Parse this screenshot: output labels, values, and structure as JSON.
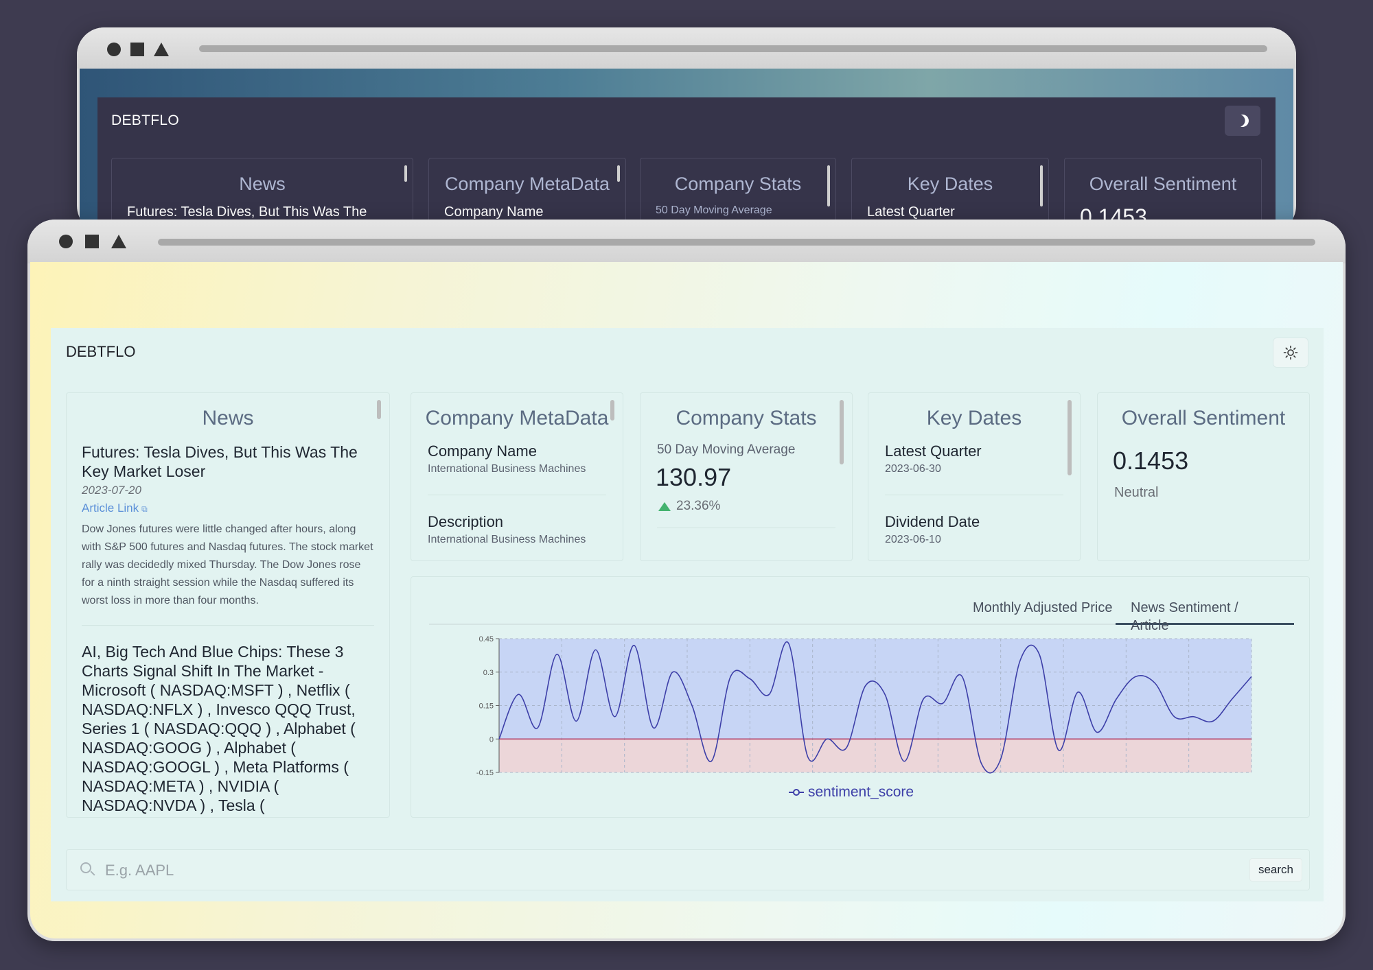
{
  "back_window": {
    "brand": "DEBTFLO",
    "theme_toggle_icon": "moon-icon",
    "cards": [
      {
        "title": "News",
        "peek": "Futures: Tesla Dives, But This Was The"
      },
      {
        "title": "Company MetaData",
        "peek": "Company Name"
      },
      {
        "title": "Company Stats",
        "peek": "50 Day Moving Average"
      },
      {
        "title": "Key Dates",
        "peek": "Latest Quarter"
      },
      {
        "title": "Overall Sentiment",
        "peek": "0.1453"
      }
    ]
  },
  "app": {
    "brand": "DEBTFLO",
    "theme_toggle_icon": "sun-icon"
  },
  "news": {
    "title": "News",
    "items": [
      {
        "title": "Futures: Tesla Dives, But This Was The Key Market Loser",
        "date": "2023-07-20",
        "link_text": "Article Link",
        "description": "Dow Jones futures were little changed after hours, along with S&P 500 futures and Nasdaq futures. The stock market rally was decidedly mixed Thursday. The Dow Jones rose for a ninth straight session while the Nasdaq suffered its worst loss in more than four months."
      },
      {
        "title": "AI, Big Tech And Blue Chips: These 3 Charts Signal Shift In The Market - Microsoft ( NASDAQ:MSFT ) , Netflix ( NASDAQ:NFLX ) , Invesco QQQ Trust, Series 1 ( NASDAQ:QQQ ) , Alphabet ( NASDAQ:GOOG ) , Alphabet ( NASDAQ:GOOGL ) , Meta Platforms ( NASDAQ:META ) , NVIDIA ( NASDAQ:NVDA ) , Tesla ( NASDAQ:TSLA )"
      }
    ]
  },
  "metadata": {
    "title": "Company MetaData",
    "fields": [
      {
        "label": "Company Name",
        "value": "International Business Machines"
      },
      {
        "label": "Description",
        "value": "International Business Machines"
      }
    ]
  },
  "stats": {
    "title": "Company Stats",
    "label": "50 Day Moving Average",
    "value": "130.97",
    "change": "23.36%",
    "change_color": "#43b36f"
  },
  "key_dates": {
    "title": "Key Dates",
    "fields": [
      {
        "label": "Latest Quarter",
        "value": "2023-06-30"
      },
      {
        "label": "Dividend Date",
        "value": "2023-06-10"
      }
    ]
  },
  "sentiment": {
    "title": "Overall Sentiment",
    "value": "0.1453",
    "label": "Neutral"
  },
  "chart_tabs": {
    "tab1": "Monthly Adjusted Price",
    "tab2": "News Sentiment / Article",
    "active": "tab2"
  },
  "chart_data": {
    "type": "line",
    "series": [
      {
        "name": "sentiment_score",
        "color": "#3d3fa8",
        "values": [
          0.0,
          0.2,
          0.05,
          0.38,
          0.08,
          0.4,
          0.1,
          0.42,
          0.05,
          0.3,
          0.15,
          -0.1,
          0.28,
          0.27,
          0.2,
          0.43,
          -0.08,
          0.0,
          -0.04,
          0.24,
          0.2,
          -0.1,
          0.18,
          0.16,
          0.28,
          -0.11,
          -0.09,
          0.35,
          0.38,
          -0.05,
          0.21,
          0.03,
          0.18,
          0.28,
          0.25,
          0.1,
          0.1,
          0.08,
          0.18,
          0.28
        ]
      }
    ],
    "ylim": [
      -0.15,
      0.45
    ],
    "yticks": [
      "-0.15",
      "0",
      "0.15",
      "0.3",
      "0.45"
    ],
    "positive_fill": "#c7d5f5",
    "negative_fill": "#ecd6d9",
    "zero_line_color": "#b04068",
    "grid": true,
    "legend": "bottom-center"
  },
  "search": {
    "placeholder": "E.g. AAPL",
    "button_label": "search",
    "icon": "search-icon"
  }
}
